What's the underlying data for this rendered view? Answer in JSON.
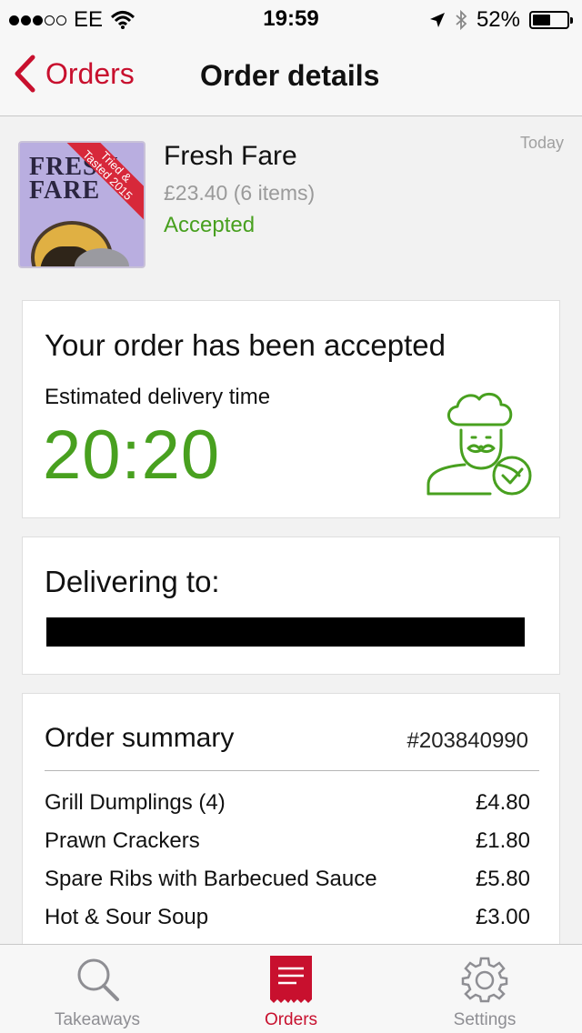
{
  "status_bar": {
    "carrier": "EE",
    "time": "19:59",
    "battery": "52%",
    "battery_level": 0.52,
    "icons": [
      "signal-dots-icon",
      "wifi-icon",
      "location-arrow-icon",
      "bluetooth-icon",
      "battery-icon"
    ]
  },
  "nav": {
    "back_label": "Orders",
    "title": "Order details"
  },
  "restaurant": {
    "logo_line1": "FRESH",
    "logo_line2": "FARE",
    "logo_banner_line1": "Tried &",
    "logo_banner_line2": "Tasted 2015",
    "name": "Fresh Fare",
    "price": "£23.40 (6 items)",
    "status": "Accepted",
    "date": "Today"
  },
  "accepted_card": {
    "title": "Your order has been accepted",
    "eta_label": "Estimated delivery time",
    "eta_time": "20:20",
    "icon": "chef-check-icon"
  },
  "delivery_card": {
    "title": "Delivering to:"
  },
  "summary": {
    "title": "Order summary",
    "order_number": "#203840990",
    "items": [
      {
        "name": "Grill Dumplings (4)",
        "price": "£4.80"
      },
      {
        "name": "Prawn Crackers",
        "price": "£1.80"
      },
      {
        "name": "Spare Ribs with Barbecued Sauce",
        "price": "£5.80"
      },
      {
        "name": "Hot & Sour Soup",
        "price": "£3.00"
      }
    ]
  },
  "tabs": [
    {
      "label": "Takeaways",
      "icon": "search-icon",
      "active": false
    },
    {
      "label": "Orders",
      "icon": "receipt-icon",
      "active": true
    },
    {
      "label": "Settings",
      "icon": "gear-icon",
      "active": false
    }
  ],
  "colors": {
    "accent": "#c8102e",
    "success": "#48a01f"
  }
}
